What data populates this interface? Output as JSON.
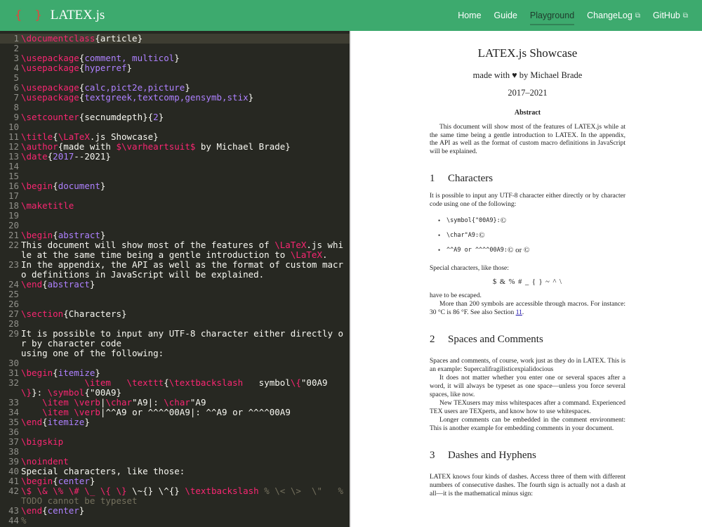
{
  "header": {
    "brand_braces": "{ }",
    "brand": "LATEX.js",
    "nav": [
      {
        "label": "Home",
        "active": false,
        "external": false
      },
      {
        "label": "Guide",
        "active": false,
        "external": false
      },
      {
        "label": "Playground",
        "active": true,
        "external": false
      },
      {
        "label": "ChangeLog",
        "active": false,
        "external": true
      },
      {
        "label": "GitHub",
        "active": false,
        "external": true
      }
    ],
    "external_icon": "external-link-icon"
  },
  "editor": {
    "lines": [
      {
        "n": "1",
        "active": true,
        "tokens": [
          {
            "c": "cmd",
            "t": "\\documentclass"
          },
          {
            "c": "",
            "t": "{article}"
          }
        ]
      },
      {
        "n": "2",
        "tokens": []
      },
      {
        "n": "3",
        "tokens": [
          {
            "c": "cmd",
            "t": "\\usepackage"
          },
          {
            "c": "",
            "t": "{"
          },
          {
            "c": "arg",
            "t": "comment, multicol"
          },
          {
            "c": "",
            "t": "}"
          }
        ]
      },
      {
        "n": "4",
        "tokens": [
          {
            "c": "cmd",
            "t": "\\usepackage"
          },
          {
            "c": "",
            "t": "{"
          },
          {
            "c": "arg",
            "t": "hyperref"
          },
          {
            "c": "",
            "t": "}"
          }
        ]
      },
      {
        "n": "5",
        "tokens": []
      },
      {
        "n": "6",
        "tokens": [
          {
            "c": "cmd",
            "t": "\\usepackage"
          },
          {
            "c": "",
            "t": "{"
          },
          {
            "c": "arg",
            "t": "calc,pict2e,picture"
          },
          {
            "c": "",
            "t": "}"
          }
        ]
      },
      {
        "n": "7",
        "tokens": [
          {
            "c": "cmd",
            "t": "\\usepackage"
          },
          {
            "c": "",
            "t": "{"
          },
          {
            "c": "arg",
            "t": "textgreek,textcomp,gensymb,stix"
          },
          {
            "c": "",
            "t": "}"
          }
        ]
      },
      {
        "n": "8",
        "tokens": []
      },
      {
        "n": "9",
        "tokens": [
          {
            "c": "cmd",
            "t": "\\setcounter"
          },
          {
            "c": "",
            "t": "{secnumdepth}{"
          },
          {
            "c": "arg",
            "t": "2"
          },
          {
            "c": "",
            "t": "}"
          }
        ]
      },
      {
        "n": "10",
        "tokens": []
      },
      {
        "n": "11",
        "tokens": [
          {
            "c": "cmd",
            "t": "\\title"
          },
          {
            "c": "",
            "t": "{"
          },
          {
            "c": "cmd",
            "t": "\\LaTeX"
          },
          {
            "c": "",
            "t": ".js Showcase}"
          }
        ]
      },
      {
        "n": "12",
        "tokens": [
          {
            "c": "cmd",
            "t": "\\author"
          },
          {
            "c": "",
            "t": "{made with "
          },
          {
            "c": "cmd",
            "t": "$\\varheartsuit$"
          },
          {
            "c": "",
            "t": " by Michael Brade}"
          }
        ]
      },
      {
        "n": "13",
        "tokens": [
          {
            "c": "cmd",
            "t": "\\date"
          },
          {
            "c": "",
            "t": "{"
          },
          {
            "c": "arg",
            "t": "2017"
          },
          {
            "c": "",
            "t": "--2021}"
          }
        ]
      },
      {
        "n": "14",
        "tokens": []
      },
      {
        "n": "15",
        "tokens": []
      },
      {
        "n": "16",
        "tokens": [
          {
            "c": "cmd",
            "t": "\\begin"
          },
          {
            "c": "",
            "t": "{"
          },
          {
            "c": "arg",
            "t": "document"
          },
          {
            "c": "",
            "t": "}"
          }
        ]
      },
      {
        "n": "17",
        "tokens": []
      },
      {
        "n": "18",
        "tokens": [
          {
            "c": "cmd",
            "t": "\\maketitle"
          }
        ]
      },
      {
        "n": "19",
        "tokens": []
      },
      {
        "n": "20",
        "tokens": []
      },
      {
        "n": "21",
        "tokens": [
          {
            "c": "cmd",
            "t": "\\begin"
          },
          {
            "c": "",
            "t": "{"
          },
          {
            "c": "arg",
            "t": "abstract"
          },
          {
            "c": "",
            "t": "}"
          }
        ]
      },
      {
        "n": "22",
        "tokens": [
          {
            "c": "",
            "t": "This document will show most of the features of "
          },
          {
            "c": "cmd",
            "t": "\\LaTeX"
          },
          {
            "c": "",
            "t": ".js while at the same time being a gentle introduction to "
          },
          {
            "c": "cmd",
            "t": "\\LaTeX"
          },
          {
            "c": "",
            "t": "."
          }
        ]
      },
      {
        "n": "23",
        "tokens": [
          {
            "c": "",
            "t": "In the appendix, the API as well as the format of custom macro definitions in JavaScript will be explained."
          }
        ]
      },
      {
        "n": "24",
        "tokens": [
          {
            "c": "cmd",
            "t": "\\end"
          },
          {
            "c": "",
            "t": "{"
          },
          {
            "c": "arg",
            "t": "abstract"
          },
          {
            "c": "",
            "t": "}"
          }
        ]
      },
      {
        "n": "25",
        "tokens": []
      },
      {
        "n": "26",
        "tokens": []
      },
      {
        "n": "27",
        "tokens": [
          {
            "c": "cmd",
            "t": "\\section"
          },
          {
            "c": "",
            "t": "{Characters}"
          }
        ]
      },
      {
        "n": "28",
        "tokens": []
      },
      {
        "n": "29",
        "tokens": [
          {
            "c": "",
            "t": "It is possible to input any UTF-8 character either directly or by character code\nusing one of the following:"
          }
        ]
      },
      {
        "n": "30",
        "tokens": []
      },
      {
        "n": "31",
        "tokens": [
          {
            "c": "cmd",
            "t": "\\begin"
          },
          {
            "c": "",
            "t": "{"
          },
          {
            "c": "arg",
            "t": "itemize"
          },
          {
            "c": "",
            "t": "}"
          }
        ]
      },
      {
        "n": "32",
        "tokens": [
          {
            "c": "",
            "t": "            "
          },
          {
            "c": "cmd",
            "t": "\\item"
          },
          {
            "c": "",
            "t": "   "
          },
          {
            "c": "cmd",
            "t": "\\texttt"
          },
          {
            "c": "",
            "t": "{"
          },
          {
            "c": "cmd",
            "t": "\\textbackslash"
          },
          {
            "c": "",
            "t": "   symbol"
          },
          {
            "c": "cmd",
            "t": "\\{"
          },
          {
            "c": "",
            "t": "\"00A9"
          },
          {
            "c": "cmd",
            "t": "\\}"
          },
          {
            "c": "",
            "t": "}: "
          },
          {
            "c": "cmd",
            "t": "\\symbol"
          },
          {
            "c": "",
            "t": "{\"00A9}"
          }
        ]
      },
      {
        "n": "33",
        "tokens": [
          {
            "c": "",
            "t": "    "
          },
          {
            "c": "cmd",
            "t": "\\item"
          },
          {
            "c": "",
            "t": " "
          },
          {
            "c": "cmd",
            "t": "\\verb"
          },
          {
            "c": "",
            "t": "|"
          },
          {
            "c": "cmd",
            "t": "\\char"
          },
          {
            "c": "",
            "t": "\"A9|: "
          },
          {
            "c": "cmd",
            "t": "\\char"
          },
          {
            "c": "",
            "t": "\"A9"
          }
        ]
      },
      {
        "n": "34",
        "tokens": [
          {
            "c": "",
            "t": "    "
          },
          {
            "c": "cmd",
            "t": "\\item"
          },
          {
            "c": "",
            "t": " "
          },
          {
            "c": "cmd",
            "t": "\\verb"
          },
          {
            "c": "",
            "t": "|^^A9 or ^^^^00A9|: ^^A9 or ^^^^00A9"
          }
        ]
      },
      {
        "n": "35",
        "tokens": [
          {
            "c": "cmd",
            "t": "\\end"
          },
          {
            "c": "",
            "t": "{"
          },
          {
            "c": "arg",
            "t": "itemize"
          },
          {
            "c": "",
            "t": "}"
          }
        ]
      },
      {
        "n": "36",
        "tokens": []
      },
      {
        "n": "37",
        "tokens": [
          {
            "c": "cmd",
            "t": "\\bigskip"
          }
        ]
      },
      {
        "n": "38",
        "tokens": []
      },
      {
        "n": "39",
        "tokens": [
          {
            "c": "cmd",
            "t": "\\noindent"
          }
        ]
      },
      {
        "n": "40",
        "tokens": [
          {
            "c": "",
            "t": "Special characters, like those:"
          }
        ]
      },
      {
        "n": "41",
        "tokens": [
          {
            "c": "cmd",
            "t": "\\begin"
          },
          {
            "c": "",
            "t": "{"
          },
          {
            "c": "arg",
            "t": "center"
          },
          {
            "c": "",
            "t": "}"
          }
        ]
      },
      {
        "n": "42",
        "tokens": [
          {
            "c": "cmd",
            "t": "\\$ \\& \\% \\# \\_ \\{ \\}"
          },
          {
            "c": "",
            "t": " \\~{} \\^{} "
          },
          {
            "c": "cmd",
            "t": "\\textbackslash"
          },
          {
            "c": "",
            "t": " "
          },
          {
            "c": "cmt",
            "t": "% \\< \\>  \\\"   % TODO cannot be typeset"
          }
        ]
      },
      {
        "n": "43",
        "tokens": [
          {
            "c": "cmd",
            "t": "\\end"
          },
          {
            "c": "",
            "t": "{"
          },
          {
            "c": "arg",
            "t": "center"
          },
          {
            "c": "",
            "t": "}"
          }
        ]
      },
      {
        "n": "44",
        "tokens": [
          {
            "c": "cmt",
            "t": "%"
          }
        ]
      }
    ]
  },
  "preview": {
    "title": "LATEX.js Showcase",
    "author": "made with ♥ by Michael Brade",
    "date": "2017–2021",
    "abstract_heading": "Abstract",
    "abstract": "This document will show most of the features of LATEX.js while at the same time being a gentle introduction to LATEX. In the appendix, the API as well as the format of custom macro definitions in JavaScript will be explained.",
    "sections": [
      {
        "num": "1",
        "title": "Characters"
      },
      {
        "num": "2",
        "title": "Spaces and Comments"
      },
      {
        "num": "3",
        "title": "Dashes and Hyphens"
      }
    ],
    "s1_intro": "It is possible to input any UTF-8 character either directly or by character code using one of the following:",
    "s1_items": [
      {
        "code": "\\symbol{\"00A9}:",
        "result": "©"
      },
      {
        "code": "\\char\"A9:",
        "result": "©"
      },
      {
        "code": "^^A9 or ^^^^00A9:",
        "result": "© or ©"
      }
    ],
    "s1_special": "Special characters, like those:",
    "s1_chars": "$ & % # _ { } ~ ^ \\",
    "s1_escaped": "have to be escaped.",
    "s1_more_pre": "More than 200 symbols are accessible through macros. For instance: 30 °C is 86 °F. See also Section ",
    "s1_more_link": "11",
    "s1_more_post": ".",
    "s2_p1": "Spaces and comments, of course, work just as they do in LATEX. This is an example: Supercalifragilisticexpialidocious",
    "s2_p2": "It does not matter whether you enter one or several spaces after a word, it will always be typeset as one space—unless you force several spaces, like  now.",
    "s2_p3": "New TEXusers may miss whitespaces after a command. Experienced TEX users are TEXperts, and know how to use whitespaces.",
    "s2_p4": "Longer comments can be embedded in the comment environment: This is another example for embedding comments in your document.",
    "s3_p1": "LATEX knows four kinds of dashes. Access three of them with different numbers of consecutive dashes. The fourth sign is actually not a dash at all—it is the mathematical minus sign:"
  }
}
